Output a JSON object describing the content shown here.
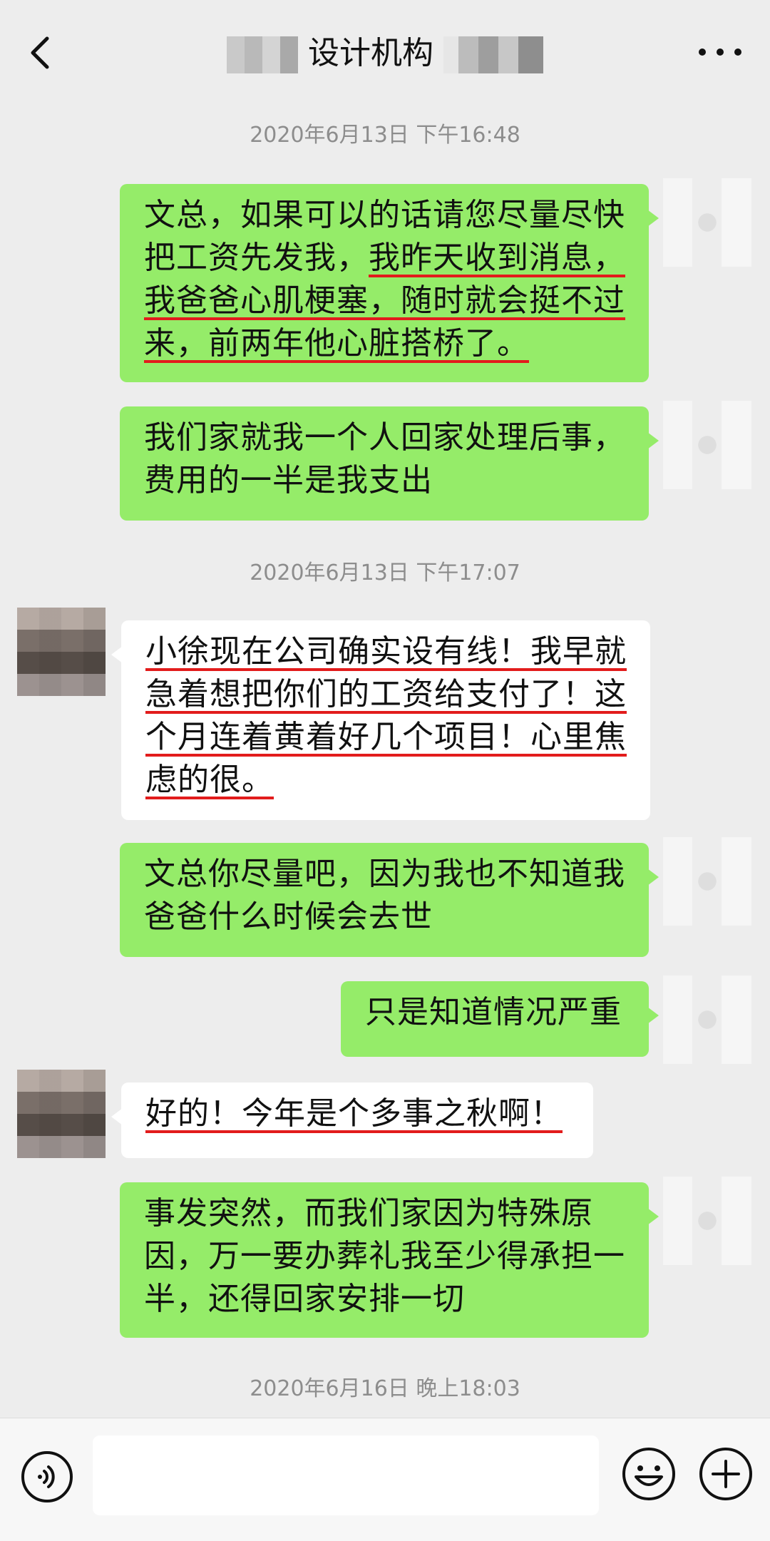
{
  "header": {
    "title": "设计机构",
    "back_icon": "chevron-left-icon",
    "more_icon": "more-dots-icon"
  },
  "colors": {
    "background": "#ededed",
    "my_bubble": "#95ec69",
    "their_bubble": "#ffffff",
    "underline": "#e21c1c"
  },
  "timestamps": {
    "t1": "2020年6月13日 下午16:48",
    "t2": "2020年6月13日 下午17:07",
    "t3": "2020年6月16日 晚上18:03"
  },
  "messages": {
    "m1": {
      "sender": "me",
      "lines": [
        "文总，如果可以的话请您尽量尽快",
        "把工资先发我，",
        "我昨天收到消息，",
        "我爸爸心肌梗塞，随时就会挺不过",
        "来，前两年他心脏搭桥了。"
      ]
    },
    "m2": {
      "sender": "me",
      "lines": [
        "我们家就我一个人回家处理后事，",
        "费用的一半是我支出"
      ]
    },
    "m3": {
      "sender": "them",
      "lines": [
        "小徐现在公司确实设有线！我早就",
        "急着想把你们的工资给支付了！这",
        "个月连着黄着好几个项目！心里焦",
        "虑的很。"
      ]
    },
    "m4": {
      "sender": "me",
      "lines": [
        "文总你尽量吧，因为我也不知道我",
        "爸爸什么时候会去世"
      ]
    },
    "m5": {
      "sender": "me",
      "lines": [
        "只是知道情况严重"
      ]
    },
    "m6": {
      "sender": "them",
      "lines": [
        "好的！今年是个多事之秋啊！"
      ]
    },
    "m7": {
      "sender": "me",
      "lines": [
        "事发突然，而我们家因为特殊原",
        "因，万一要办葬礼我至少得承担一",
        "半，还得回家安排一切"
      ]
    }
  },
  "input_bar": {
    "voice_icon": "voice-icon",
    "input_value": "",
    "emoji_icon": "emoji-icon",
    "plus_icon": "plus-icon"
  }
}
